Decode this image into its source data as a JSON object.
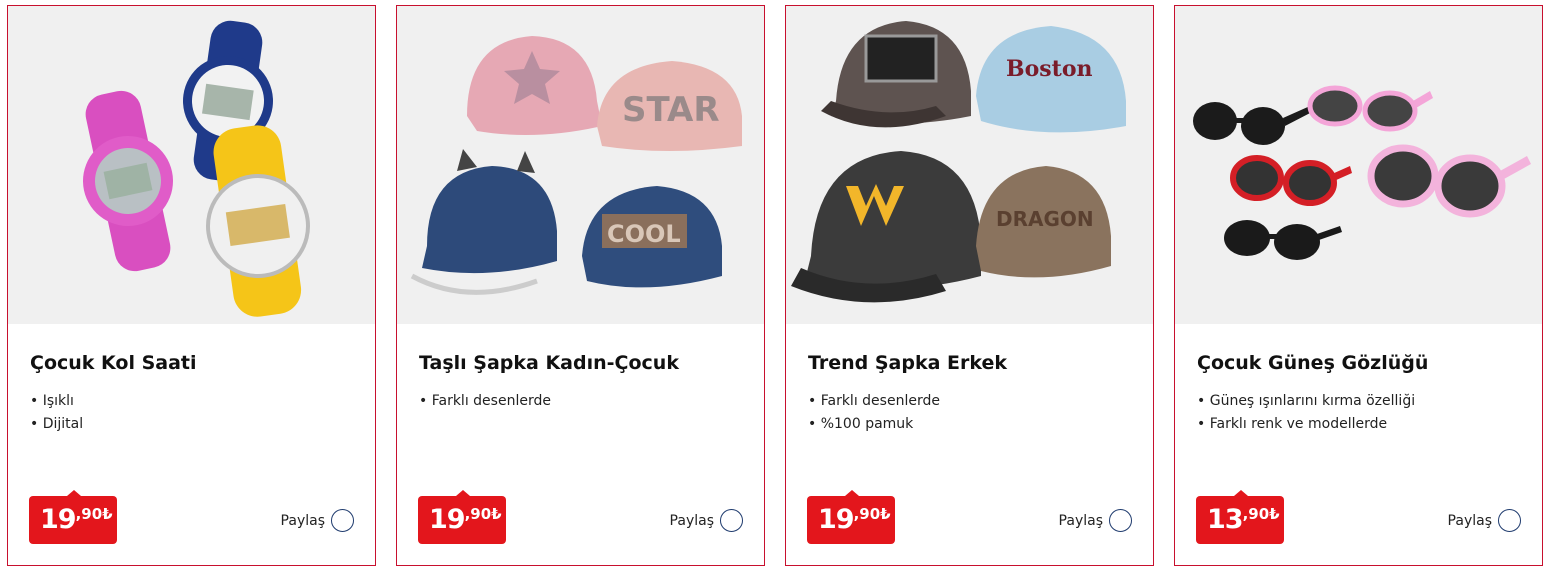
{
  "products": [
    {
      "title": "Çocuk Kol Saati",
      "features": [
        "Işıklı",
        "Dijital"
      ],
      "price_int": "19",
      "price_dec": ",90₺",
      "share_label": "Paylaş",
      "image_icon": "kids-watches-image"
    },
    {
      "title": "Taşlı Şapka Kadın-Çocuk",
      "features": [
        "Farklı desenlerde"
      ],
      "price_int": "19",
      "price_dec": ",90₺",
      "share_label": "Paylaş",
      "image_icon": "rhinestone-caps-image"
    },
    {
      "title": "Trend Şapka Erkek",
      "features": [
        "Farklı desenlerde",
        "%100 pamuk"
      ],
      "price_int": "19",
      "price_dec": ",90₺",
      "share_label": "Paylaş",
      "image_icon": "mens-caps-image"
    },
    {
      "title": "Çocuk Güneş Gözlüğü",
      "features": [
        "Güneş ışınlarını kırma özelliği",
        "Farklı renk ve modellerde"
      ],
      "price_int": "13",
      "price_dec": ",90₺",
      "share_label": "Paylaş",
      "image_icon": "kids-sunglasses-image"
    }
  ],
  "colors": {
    "border": "#c8102e",
    "price_bg": "#e3161c",
    "share_ring": "#1f3b6e",
    "image_bg": "#f0f0f0"
  }
}
